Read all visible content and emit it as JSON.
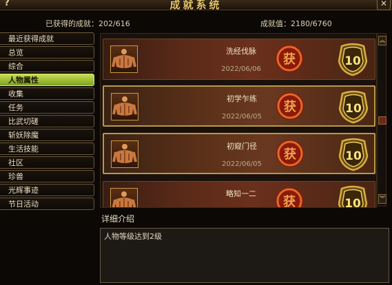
{
  "window": {
    "title": "成就系统",
    "help": "?",
    "close": "✕"
  },
  "stats": {
    "earned_label": "已获得的成就：",
    "earned_value": "202/616",
    "points_label": "成就值：",
    "points_value": "2180/6760"
  },
  "sidebar": {
    "items": [
      {
        "label": "最近获得成就",
        "active": false
      },
      {
        "label": "总览",
        "active": false
      },
      {
        "label": "综合",
        "active": false
      },
      {
        "label": "人物属性",
        "active": true
      },
      {
        "label": "收集",
        "active": false
      },
      {
        "label": "任务",
        "active": false
      },
      {
        "label": "比武切磋",
        "active": false
      },
      {
        "label": "斩妖除魔",
        "active": false
      },
      {
        "label": "生活技能",
        "active": false
      },
      {
        "label": "社区",
        "active": false
      },
      {
        "label": "珍兽",
        "active": false
      },
      {
        "label": "光辉事迹",
        "active": false
      },
      {
        "label": "节日活动",
        "active": false
      }
    ]
  },
  "achievements": [
    {
      "name": "洗经伐脉",
      "date": "2022/06/06",
      "points": "10",
      "seal_char": "获",
      "highlight": false
    },
    {
      "name": "初学乍练",
      "date": "2022/06/05",
      "points": "10",
      "seal_char": "获",
      "highlight": true
    },
    {
      "name": "初窥门径",
      "date": "2022/06/05",
      "points": "10",
      "seal_char": "获",
      "highlight": true
    },
    {
      "name": "略知一二",
      "date": "",
      "points": "10",
      "seal_char": "获",
      "highlight": false
    }
  ],
  "detail": {
    "heading": "详细介绍",
    "text": "人物等级达到2级"
  },
  "colors": {
    "accent": "#e7c46a",
    "active_tab": "#a6c23a",
    "row_red": "#5b2a18",
    "seal_red": "#c0301a"
  }
}
